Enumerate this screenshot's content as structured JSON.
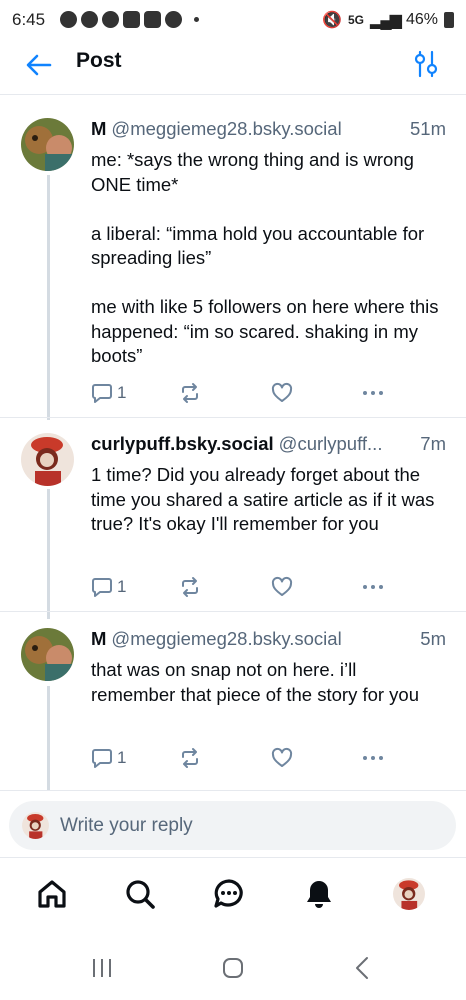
{
  "status_bar": {
    "time": "6:45",
    "network": "5G",
    "battery": "46%"
  },
  "header": {
    "title": "Post"
  },
  "posts": [
    {
      "author": "M",
      "handle": "@meggiemeg28.bsky.social",
      "time": "51m",
      "text": "me: *says the wrong thing and is wrong ONE time*\n\na liberal: “imma hold you accountable for spreading lies”\n\nme with like 5 followers on here where this happened: “im so scared. shaking in my boots”",
      "reply_count": "1"
    },
    {
      "author": "curlypuff.bsky.social",
      "handle": "@curlypuff...",
      "time": "7m",
      "text": "1 time? Did you already forget about the time you shared a satire article as if it was true? It's okay I'll remember for you",
      "reply_count": "1"
    },
    {
      "author": "M",
      "handle": "@meggiemeg28.bsky.social",
      "time": "5m",
      "text": "that was on snap not on here. i’ll remember that piece of the story for you",
      "reply_count": "1"
    }
  ],
  "reply_bar": {
    "placeholder": "Write your reply"
  },
  "colors": {
    "accent": "#1083fe",
    "icon_gray": "#6f869f",
    "text_secondary": "#56677a",
    "thread_line": "#d4dbe2"
  },
  "icons": {
    "back": "arrow-left-icon",
    "filter": "sliders-icon",
    "reply": "speech-bubble-icon",
    "repost": "repost-arrows-icon",
    "like": "heart-icon",
    "more": "ellipsis-icon",
    "nav": [
      "home-icon",
      "search-icon",
      "chat-icon",
      "bell-icon",
      "profile-avatar"
    ]
  }
}
